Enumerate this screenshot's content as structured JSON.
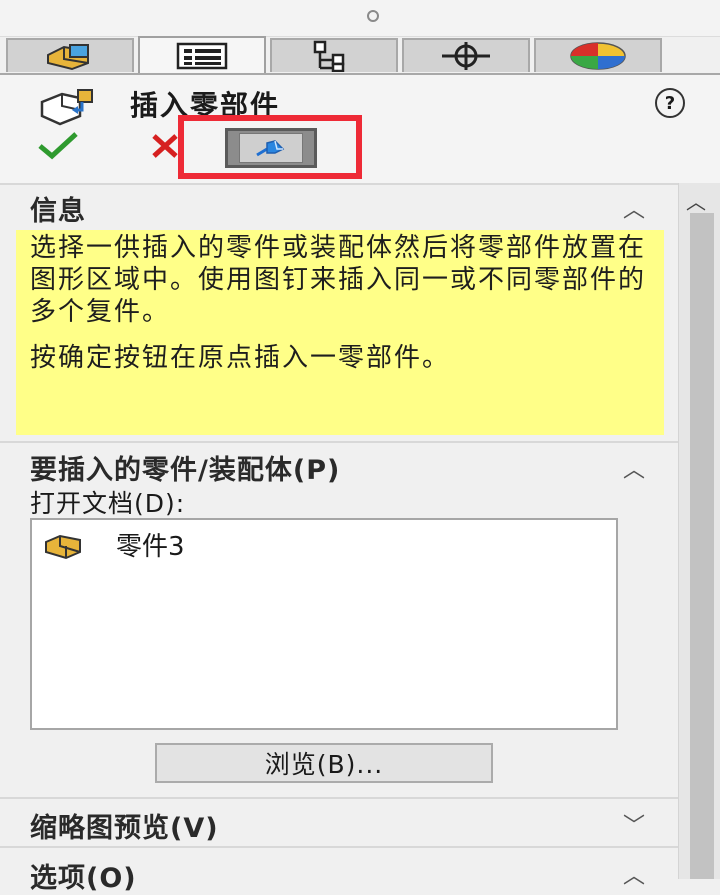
{
  "panel": {
    "title": "插入零部件",
    "help": "?",
    "ok_icon": "check-icon",
    "cancel_icon": "close-icon",
    "pin_icon": "pushpin-icon"
  },
  "tabs": [
    {
      "icon": "feature-manager-icon"
    },
    {
      "icon": "property-manager-icon"
    },
    {
      "icon": "configuration-manager-icon"
    },
    {
      "icon": "dimxpert-manager-icon"
    },
    {
      "icon": "display-manager-icon"
    }
  ],
  "info": {
    "title": "信息",
    "text1": "选择一供插入的零件或装配体然后将零部件放置在图形区域中。使用图钉来插入同一或不同零部件的多个复件。",
    "text2": "按确定按钮在原点插入一零部件。"
  },
  "insert": {
    "title": "要插入的零件/装配体(P)",
    "open_docs_label": "打开文档(D):",
    "items": [
      {
        "label": "零件3",
        "icon": "part-icon"
      }
    ],
    "browse": "浏览(B)..."
  },
  "thumbnail": {
    "title": "缩略图预览(V)"
  },
  "options": {
    "title": "选项(O)"
  },
  "colors": {
    "highlight": "#ee2a36",
    "info_bg": "#ffff88",
    "ok": "#2e9a2e",
    "cancel": "#d62020"
  }
}
